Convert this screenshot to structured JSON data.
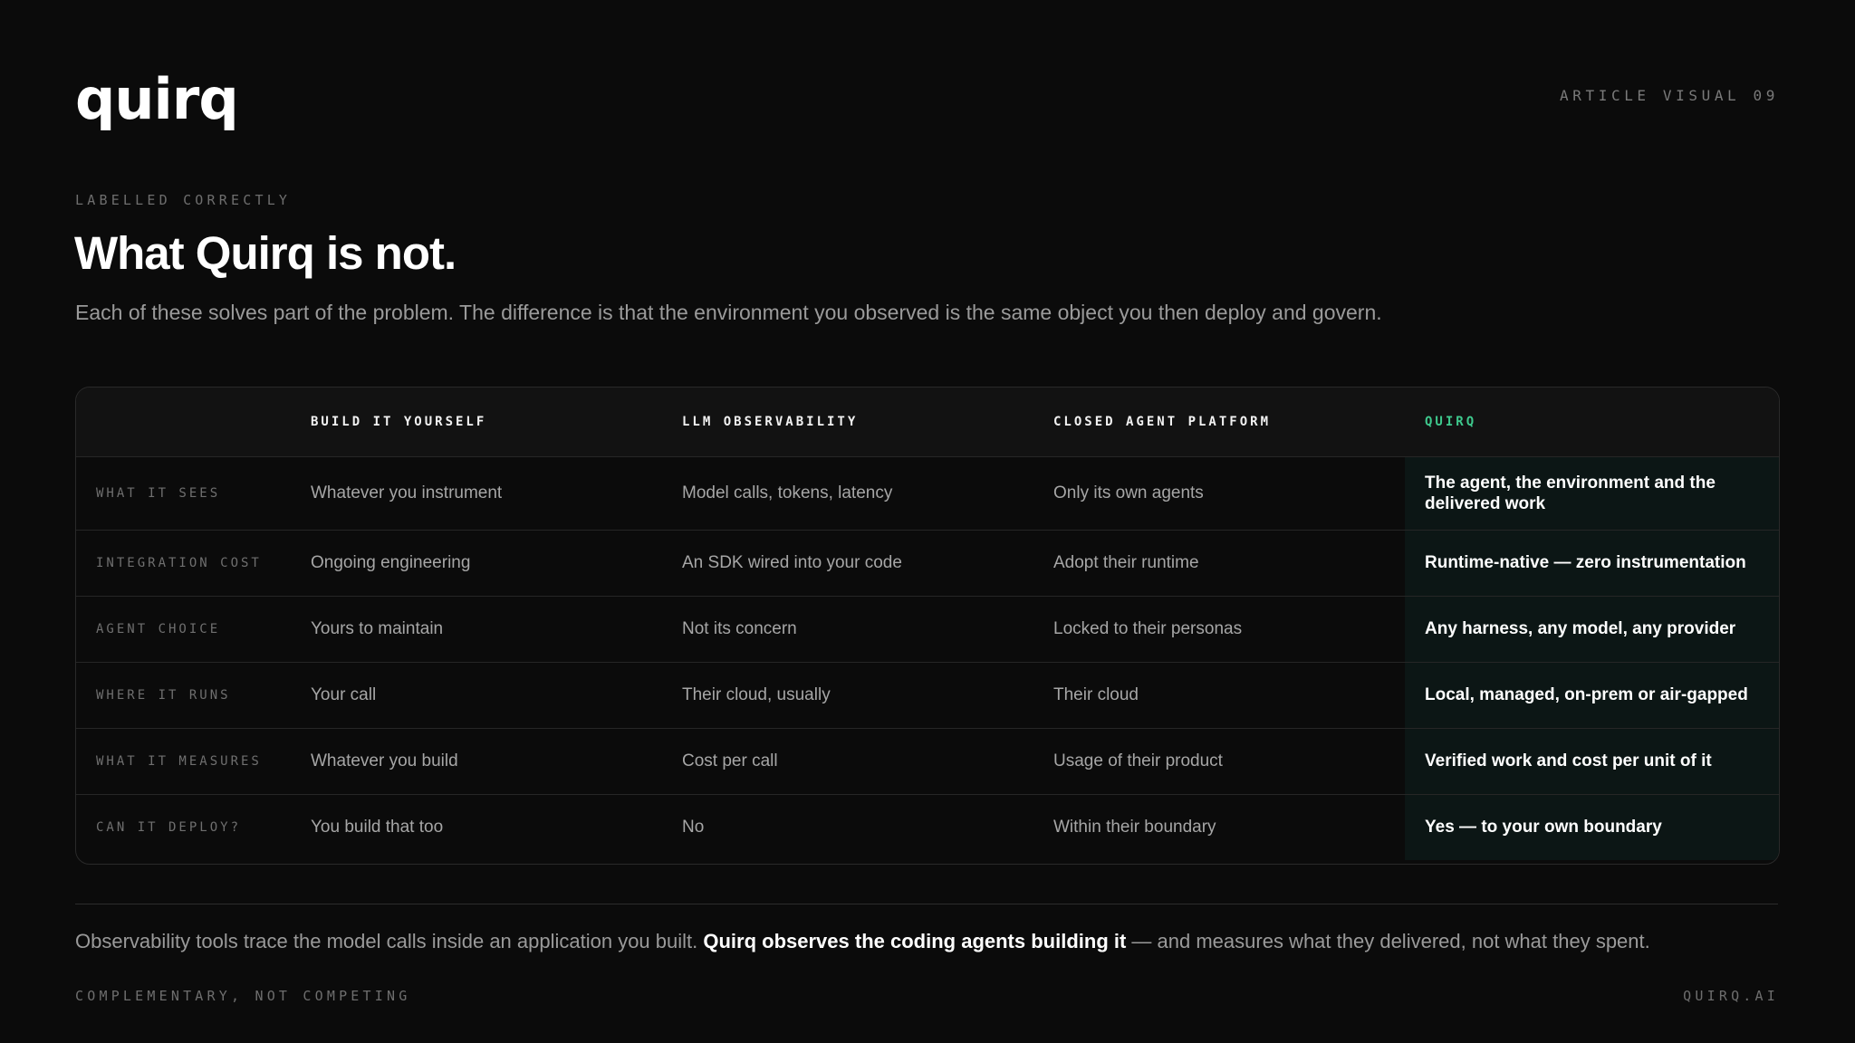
{
  "brand": {
    "logo_text": "quirq",
    "visual_tag": "ARTICLE VISUAL 09"
  },
  "intro": {
    "eyebrow": "LABELLED CORRECTLY",
    "title": "What Quirq is not.",
    "subtitle": "Each of these solves part of the problem. The difference is that the environment you observed is the same object you then deploy and govern."
  },
  "table": {
    "headers": [
      "",
      "BUILD IT YOURSELF",
      "LLM OBSERVABILITY",
      "CLOSED AGENT PLATFORM",
      "QUIRQ"
    ],
    "rows": [
      {
        "label": "WHAT IT SEES",
        "cells": [
          "Whatever you instrument",
          "Model calls, tokens, latency",
          "Only its own agents",
          "The agent, the environment and the delivered work"
        ]
      },
      {
        "label": "INTEGRATION COST",
        "cells": [
          "Ongoing engineering",
          "An SDK wired into your code",
          "Adopt their runtime",
          "Runtime-native — zero instrumentation"
        ]
      },
      {
        "label": "AGENT CHOICE",
        "cells": [
          "Yours to maintain",
          "Not its concern",
          "Locked to their personas",
          "Any harness, any model, any provider"
        ]
      },
      {
        "label": "WHERE IT RUNS",
        "cells": [
          "Your call",
          "Their cloud, usually",
          "Their cloud",
          "Local, managed, on-prem or air-gapped"
        ]
      },
      {
        "label": "WHAT IT MEASURES",
        "cells": [
          "Whatever you build",
          "Cost per call",
          "Usage of their product",
          "Verified work and cost per unit of it"
        ]
      },
      {
        "label": "CAN IT DEPLOY?",
        "cells": [
          "You build that too",
          "No",
          "Within their boundary",
          "Yes — to your own boundary"
        ]
      }
    ]
  },
  "footer": {
    "note_lead": "Observability tools trace the model calls inside an application you built. ",
    "note_emphasis": "Quirq observes the coding agents building it",
    "note_tail": " — and measures what they delivered, not what they spent.",
    "tag_left": "COMPLEMENTARY, NOT COMPETING",
    "tag_right": "QUIRQ.AI"
  },
  "colors": {
    "background": "#0b0b0b",
    "accent": "#3ec98d",
    "highlight_column": "#0c1615"
  }
}
